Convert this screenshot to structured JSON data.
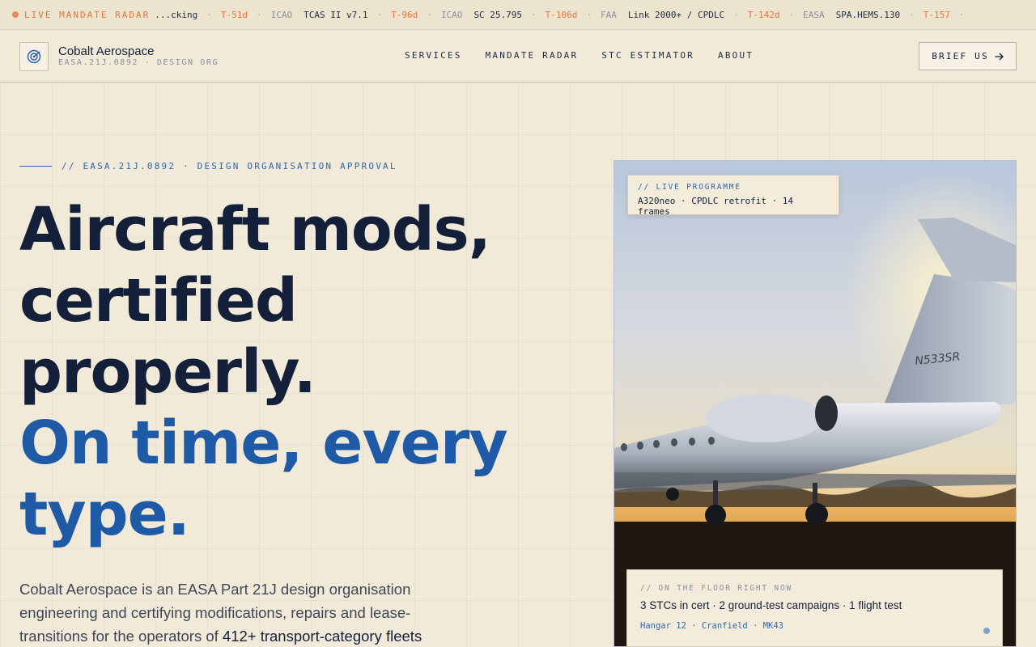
{
  "ticker": {
    "live_label": "LIVE MANDATE RADAR",
    "items": [
      {
        "name": "...cking",
        "days": "T-51d",
        "authority": "ICAO"
      },
      {
        "name": "TCAS II v7.1",
        "days": "T-96d",
        "authority": "ICAO"
      },
      {
        "name": "SC 25.795",
        "days": "T-106d",
        "authority": "FAA"
      },
      {
        "name": "Link 2000+ / CPDLC",
        "days": "T-142d",
        "authority": "EASA"
      },
      {
        "name": "SPA.HEMS.130",
        "days": "T-157",
        "authority": ""
      }
    ]
  },
  "header": {
    "brand_name": "Cobalt Aerospace",
    "brand_sub": "EASA.21J.0892 · DESIGN ORG",
    "nav": [
      "SERVICES",
      "MANDATE RADAR",
      "STC ESTIMATOR",
      "ABOUT"
    ],
    "cta": "BRIEF US",
    "cta_icon": "arrow-right-icon"
  },
  "hero": {
    "eyebrow": "// EASA.21J.0892 · DESIGN ORGANISATION APPROVAL",
    "headline_line1": "Aircraft mods,",
    "headline_line2": "certified",
    "headline_line3": "properly.",
    "headline_line4": "On time, every",
    "headline_line5": "type.",
    "intro_text": "Cobalt Aerospace is an EASA Part 21J design organisation engineering and certifying modifications, repairs and lease-transitions for the operators of ",
    "intro_highlight": "412+ transport-category fleets"
  },
  "photo": {
    "tail_reg": "N533SR",
    "live_chip": {
      "label": "// LIVE PROGRAMME",
      "value": "A320neo · CPDLC retrofit · 14 frames"
    },
    "floor_card": {
      "label": "// ON THE FLOOR RIGHT NOW",
      "stat": "3 STCs in cert · 2 ground-test campaigns · 1 flight test",
      "location": "Hangar 12 · Cranfield · MK43"
    }
  },
  "colors": {
    "background": "#f1ead9",
    "ink": "#14203a",
    "accent_blue": "#1f5aa6",
    "accent_orange": "#e2743f"
  }
}
